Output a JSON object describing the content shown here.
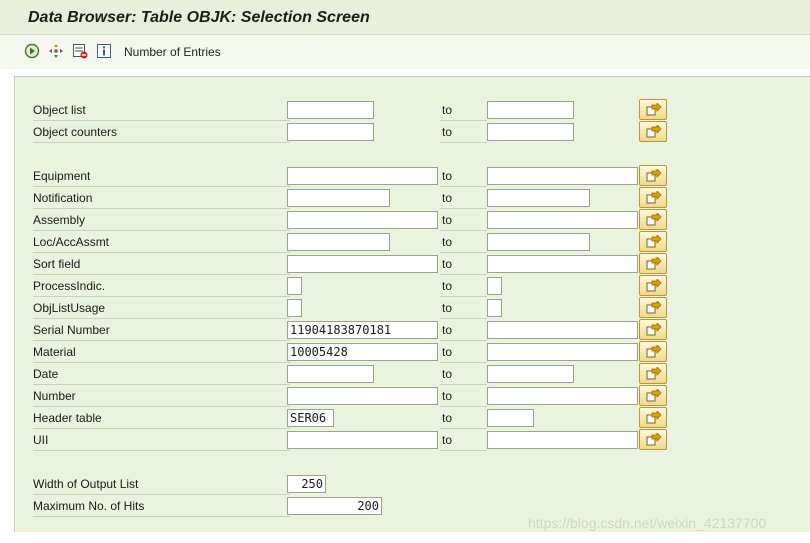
{
  "window": {
    "title": "Data Browser: Table OBJK: Selection Screen"
  },
  "toolbar": {
    "icons": [
      "execute-icon",
      "multiple-selection-icon",
      "fields-selection-icon",
      "info-icon"
    ],
    "number_of_entries_label": "Number of Entries"
  },
  "fields": [
    {
      "label": "Object list",
      "low": "",
      "high": ""
    },
    {
      "label": "Object counters",
      "low": "",
      "high": ""
    },
    {
      "label": "Equipment",
      "low": "",
      "high": ""
    },
    {
      "label": "Notification",
      "low": "",
      "high": ""
    },
    {
      "label": "Assembly",
      "low": "",
      "high": ""
    },
    {
      "label": "Loc/AccAssmt",
      "low": "",
      "high": ""
    },
    {
      "label": "Sort field",
      "low": "",
      "high": ""
    },
    {
      "label": "ProcessIndic.",
      "low": "",
      "high": ""
    },
    {
      "label": "ObjListUsage",
      "low": "",
      "high": ""
    },
    {
      "label": "Serial Number",
      "low": "11904183870181",
      "high": ""
    },
    {
      "label": "Material",
      "low": "10005428",
      "high": ""
    },
    {
      "label": "Date",
      "low": "",
      "high": ""
    },
    {
      "label": "Number",
      "low": "",
      "high": ""
    },
    {
      "label": "Header table",
      "low": "SER06",
      "high": ""
    },
    {
      "label": "UII",
      "low": "",
      "high": ""
    }
  ],
  "to_label": "to",
  "settings": {
    "width_label": "Width of Output List",
    "width_value": "250",
    "max_hits_label": "Maximum No. of Hits",
    "max_hits_value": "200"
  },
  "watermark": "https://blog.csdn.net/weixin_42137700",
  "colors": {
    "panel_bg": "#eaf3de",
    "title_bg": "#e8f0dc",
    "button_yellow": "#f1d98a"
  }
}
